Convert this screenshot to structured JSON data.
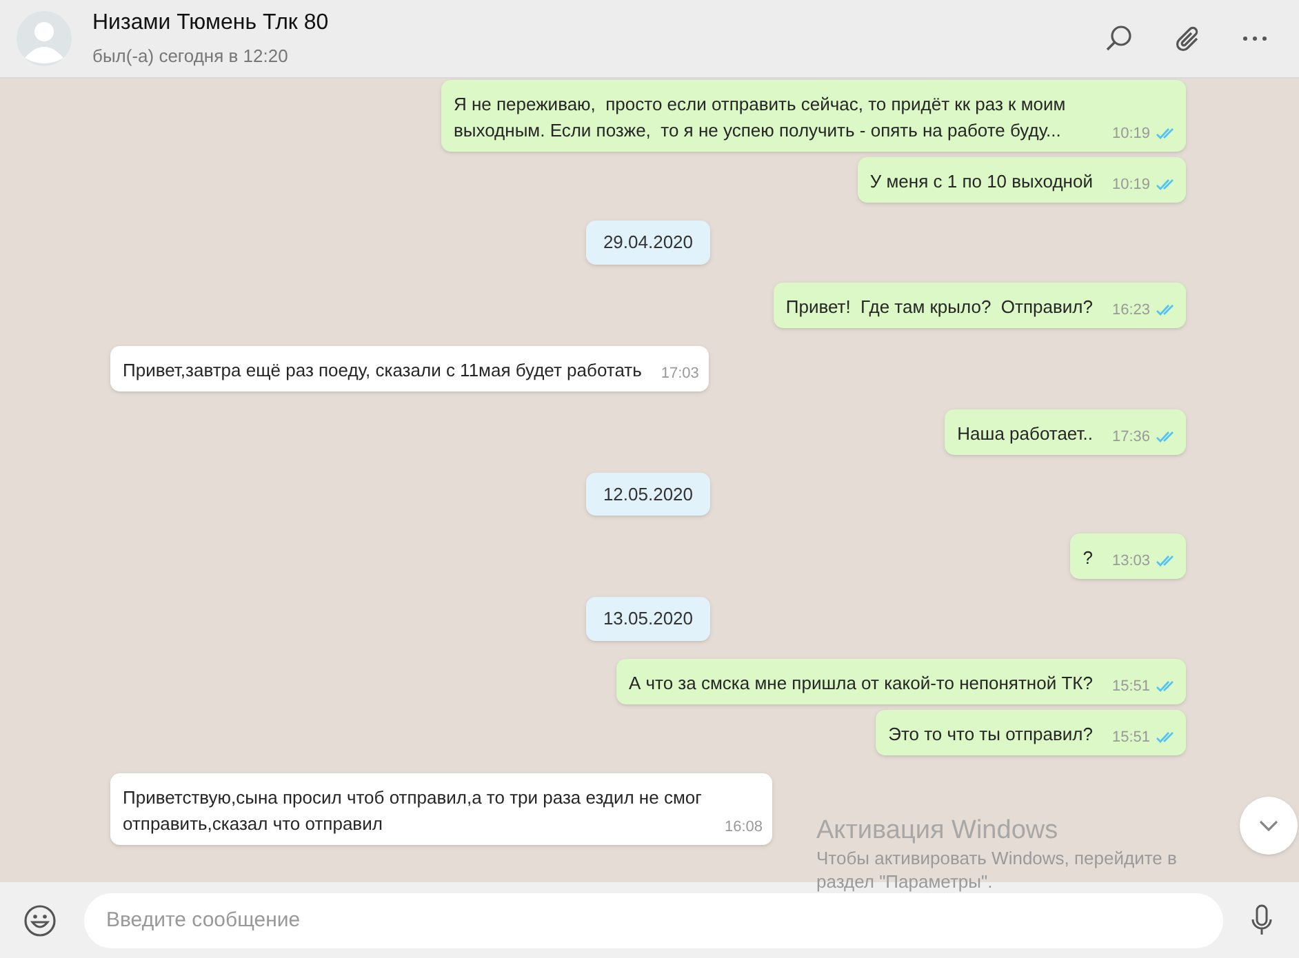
{
  "header": {
    "name": "Низами Тюмень Тлк 80",
    "last_seen": "был(-а) сегодня в 12:20"
  },
  "messages": [
    {
      "kind": "out",
      "text": "Я не переживаю,  просто если отправить сейчас, то придёт кк раз к моим выходным. Если позже,  то я не успею получить - опять на работе буду...",
      "time": "10:19",
      "read": true
    },
    {
      "kind": "out",
      "text": "У меня с 1 по 10 выходной",
      "time": "10:19",
      "read": true
    },
    {
      "kind": "date",
      "text": "29.04.2020"
    },
    {
      "kind": "out",
      "text": "Привет!  Где там крыло?  Отправил?",
      "time": "16:23",
      "read": true
    },
    {
      "kind": "in",
      "text": "Привет,завтра ещё раз поеду, сказали с 11мая будет работать",
      "time": "17:03"
    },
    {
      "kind": "out",
      "text": "Наша работает..",
      "time": "17:36",
      "read": true
    },
    {
      "kind": "date",
      "text": "12.05.2020"
    },
    {
      "kind": "out",
      "text": "?",
      "time": "13:03",
      "read": true
    },
    {
      "kind": "date",
      "text": "13.05.2020"
    },
    {
      "kind": "out",
      "text": "А что за смска мне пришла от какой-то непонятной ТК?",
      "time": "15:51",
      "read": true
    },
    {
      "kind": "out",
      "text": "Это то что ты отправил?",
      "time": "15:51",
      "read": true
    },
    {
      "kind": "in",
      "text": "Приветствую,сына просил чтоб отправил,а то три раза ездил не смог отправить,сказал что отправил",
      "time": "16:08"
    }
  ],
  "activation": {
    "title": "Активация Windows",
    "text": "Чтобы активировать Windows, перейдите в раздел \"Параметры\"."
  },
  "composer": {
    "placeholder": "Введите сообщение"
  }
}
